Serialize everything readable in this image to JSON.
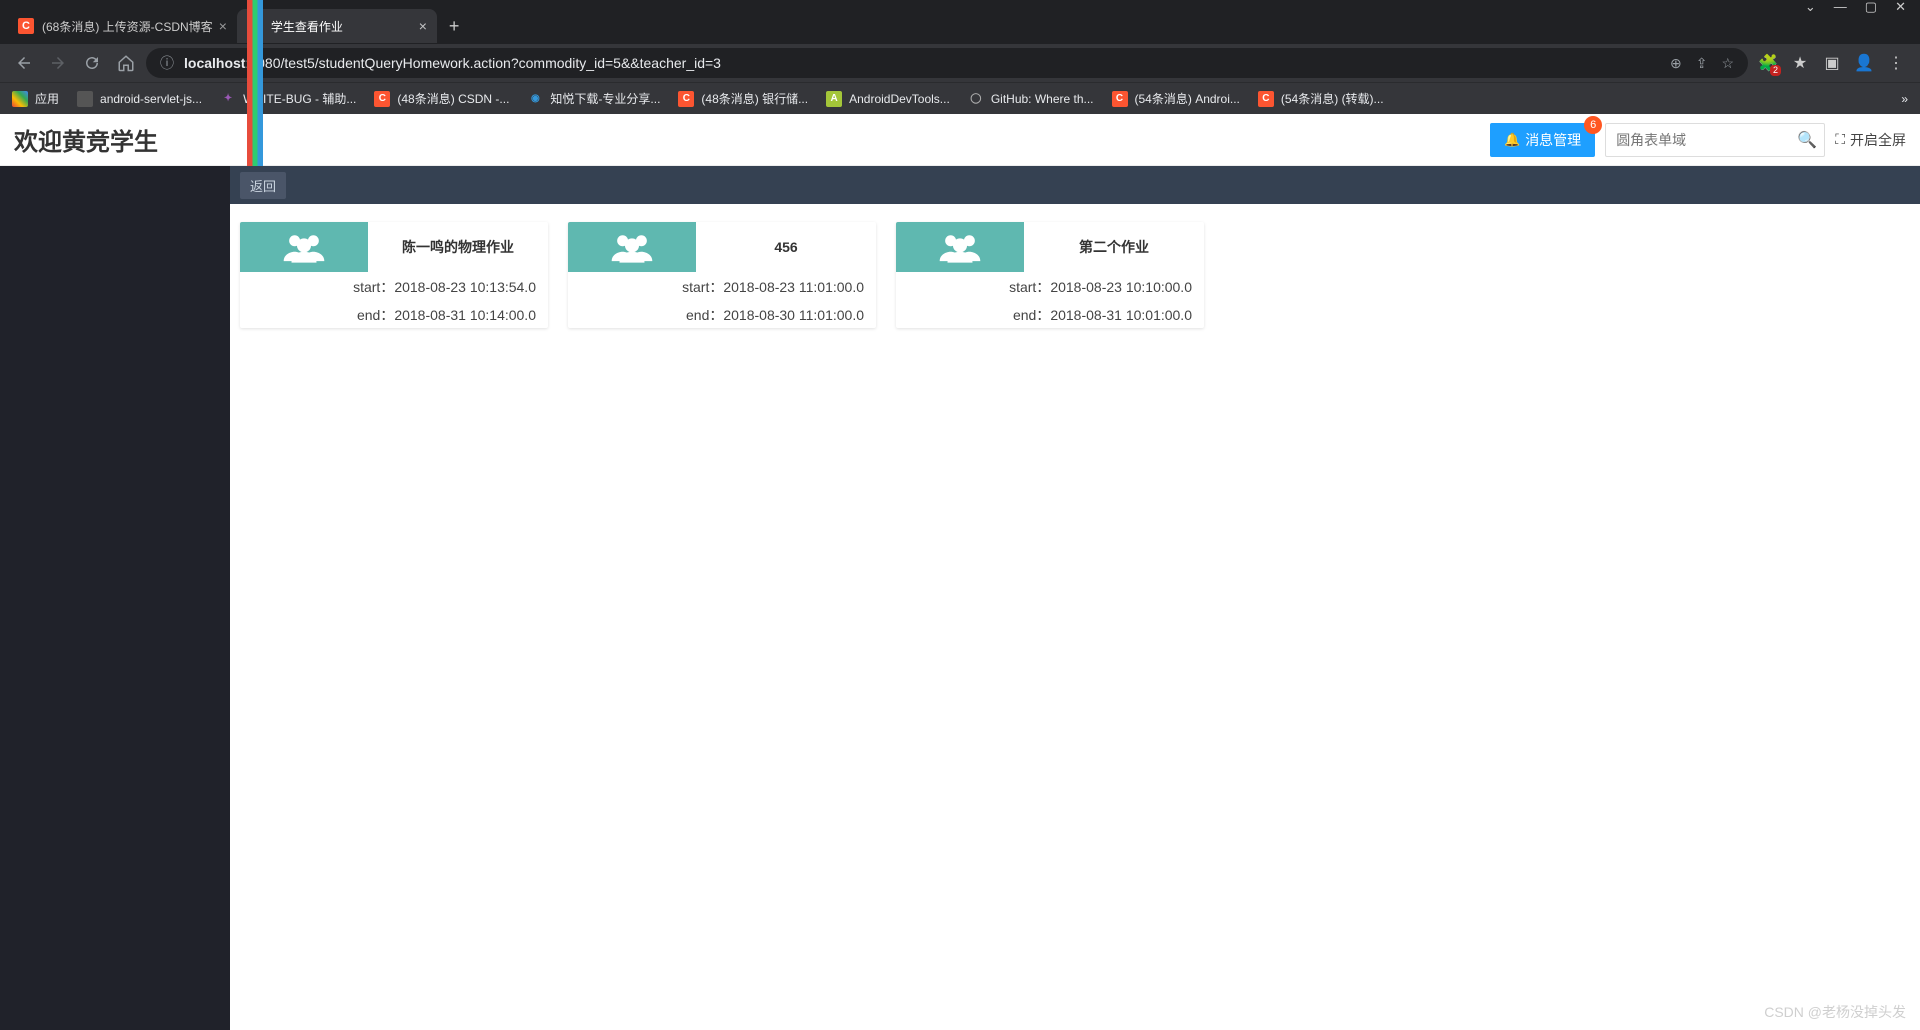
{
  "browser": {
    "tabs": [
      {
        "title": "(68条消息) 上传资源-CSDN博客",
        "favicon": "csdn",
        "active": false
      },
      {
        "title": "学生查看作业",
        "favicon": "app",
        "active": true
      }
    ],
    "url_host": "localhost",
    "url_path": ":8080/test5/studentQueryHomework.action?commodity_id=5&&teacher_id=3",
    "bookmarks": [
      {
        "label": "应用",
        "icon": "apps"
      },
      {
        "label": "android-servlet-js...",
        "icon": "blank"
      },
      {
        "label": "WRITE-BUG - 辅助...",
        "icon": "writebug"
      },
      {
        "label": "(48条消息) CSDN -...",
        "icon": "csdn"
      },
      {
        "label": "知悦下载-专业分享...",
        "icon": "zhiyue"
      },
      {
        "label": "(48条消息) 银行储...",
        "icon": "csdn"
      },
      {
        "label": "AndroidDevTools...",
        "icon": "android"
      },
      {
        "label": "GitHub: Where th...",
        "icon": "github"
      },
      {
        "label": "(54条消息) Androi...",
        "icon": "csdn"
      },
      {
        "label": "(54条消息) (转载)...",
        "icon": "csdn"
      }
    ],
    "ext_badge": "2"
  },
  "app": {
    "title": "欢迎黄竞学生",
    "msg_button": "消息管理",
    "msg_count": "6",
    "search_placeholder": "圆角表单域",
    "fullscreen_label": "开启全屏",
    "back_label": "返回",
    "cards": [
      {
        "title": "陈一鸣的物理作业",
        "start_label": "start：",
        "start": "2018-08-23 10:13:54.0",
        "end_label": "end：",
        "end": "2018-08-31 10:14:00.0"
      },
      {
        "title": "456",
        "start_label": "start：",
        "start": "2018-08-23 11:01:00.0",
        "end_label": "end：",
        "end": "2018-08-30 11:01:00.0"
      },
      {
        "title": "第二个作业",
        "start_label": "start：",
        "start": "2018-08-23 10:10:00.0",
        "end_label": "end：",
        "end": "2018-08-31 10:01:00.0"
      }
    ]
  },
  "watermark": "CSDN @老杨没掉头发"
}
